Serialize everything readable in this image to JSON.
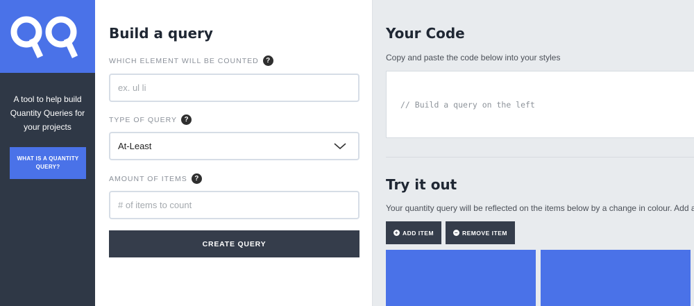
{
  "sidebar": {
    "tagline": "A tool to help build Quantity Queries for your projects",
    "info_button": "WHAT IS A QUANTITY QUERY?",
    "logo_icon": "qq-logo-icon"
  },
  "form": {
    "title": "Build a query",
    "element_label": "WHICH ELEMENT WILL BE COUNTED",
    "element_placeholder": "ex. ul li",
    "element_value": "",
    "type_label": "TYPE OF QUERY",
    "type_value": "At-Least",
    "amount_label": "AMOUNT OF ITEMS",
    "amount_placeholder": "# of items to count",
    "amount_value": "",
    "help_glyph": "?",
    "submit": "CREATE QUERY"
  },
  "code": {
    "title": "Your Code",
    "instructions": "Copy and paste the code below into your styles",
    "placeholder_code": "// Build a query on the left"
  },
  "tryout": {
    "title": "Try it out",
    "instructions": "Your quantity query will be reflected on the items below by a change in colour. Add a",
    "add_button": "ADD ITEM",
    "remove_button": "REMOVE ITEM",
    "add_icon": "+",
    "remove_icon": "−",
    "item_count_visible": 2
  },
  "colors": {
    "accent": "#4a72e8",
    "sidebar_bg": "#2f3846",
    "button_dark": "#353d4b",
    "panel_bg": "#e8ebee"
  }
}
